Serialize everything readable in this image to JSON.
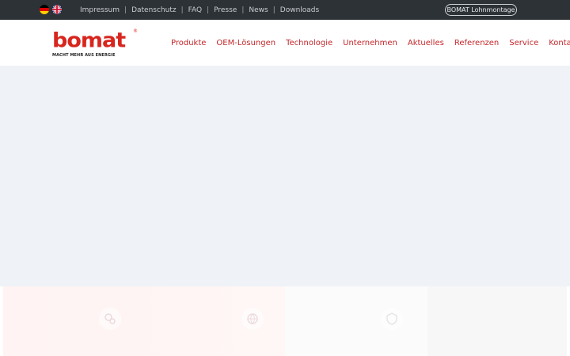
{
  "topbar": {
    "languages": [
      "de-flag-icon",
      "gb-flag-icon"
    ],
    "links": [
      "Impressum",
      "Datenschutz",
      "FAQ",
      "Presse",
      "News",
      "Downloads"
    ],
    "separator": "|",
    "cta_label": "BOMAT Lohnmontage"
  },
  "header": {
    "logo_text": "bomat",
    "logo_registered": "®",
    "logo_tagline": "MACHT MEHR AUS ENERGIE",
    "nav": [
      "Produkte",
      "OEM-Lösungen",
      "Technologie",
      "Unternehmen",
      "Aktuelles",
      "Referenzen",
      "Service",
      "Kontakt"
    ]
  },
  "colors": {
    "topbar_bg": "#2d3236",
    "brand_red": "#d7261e",
    "nav_red": "#c3272b",
    "hero_bg": "#eff2f6"
  },
  "tiles": {
    "icons": [
      "gears-icon",
      "globe-icon",
      "shield-icon"
    ]
  }
}
